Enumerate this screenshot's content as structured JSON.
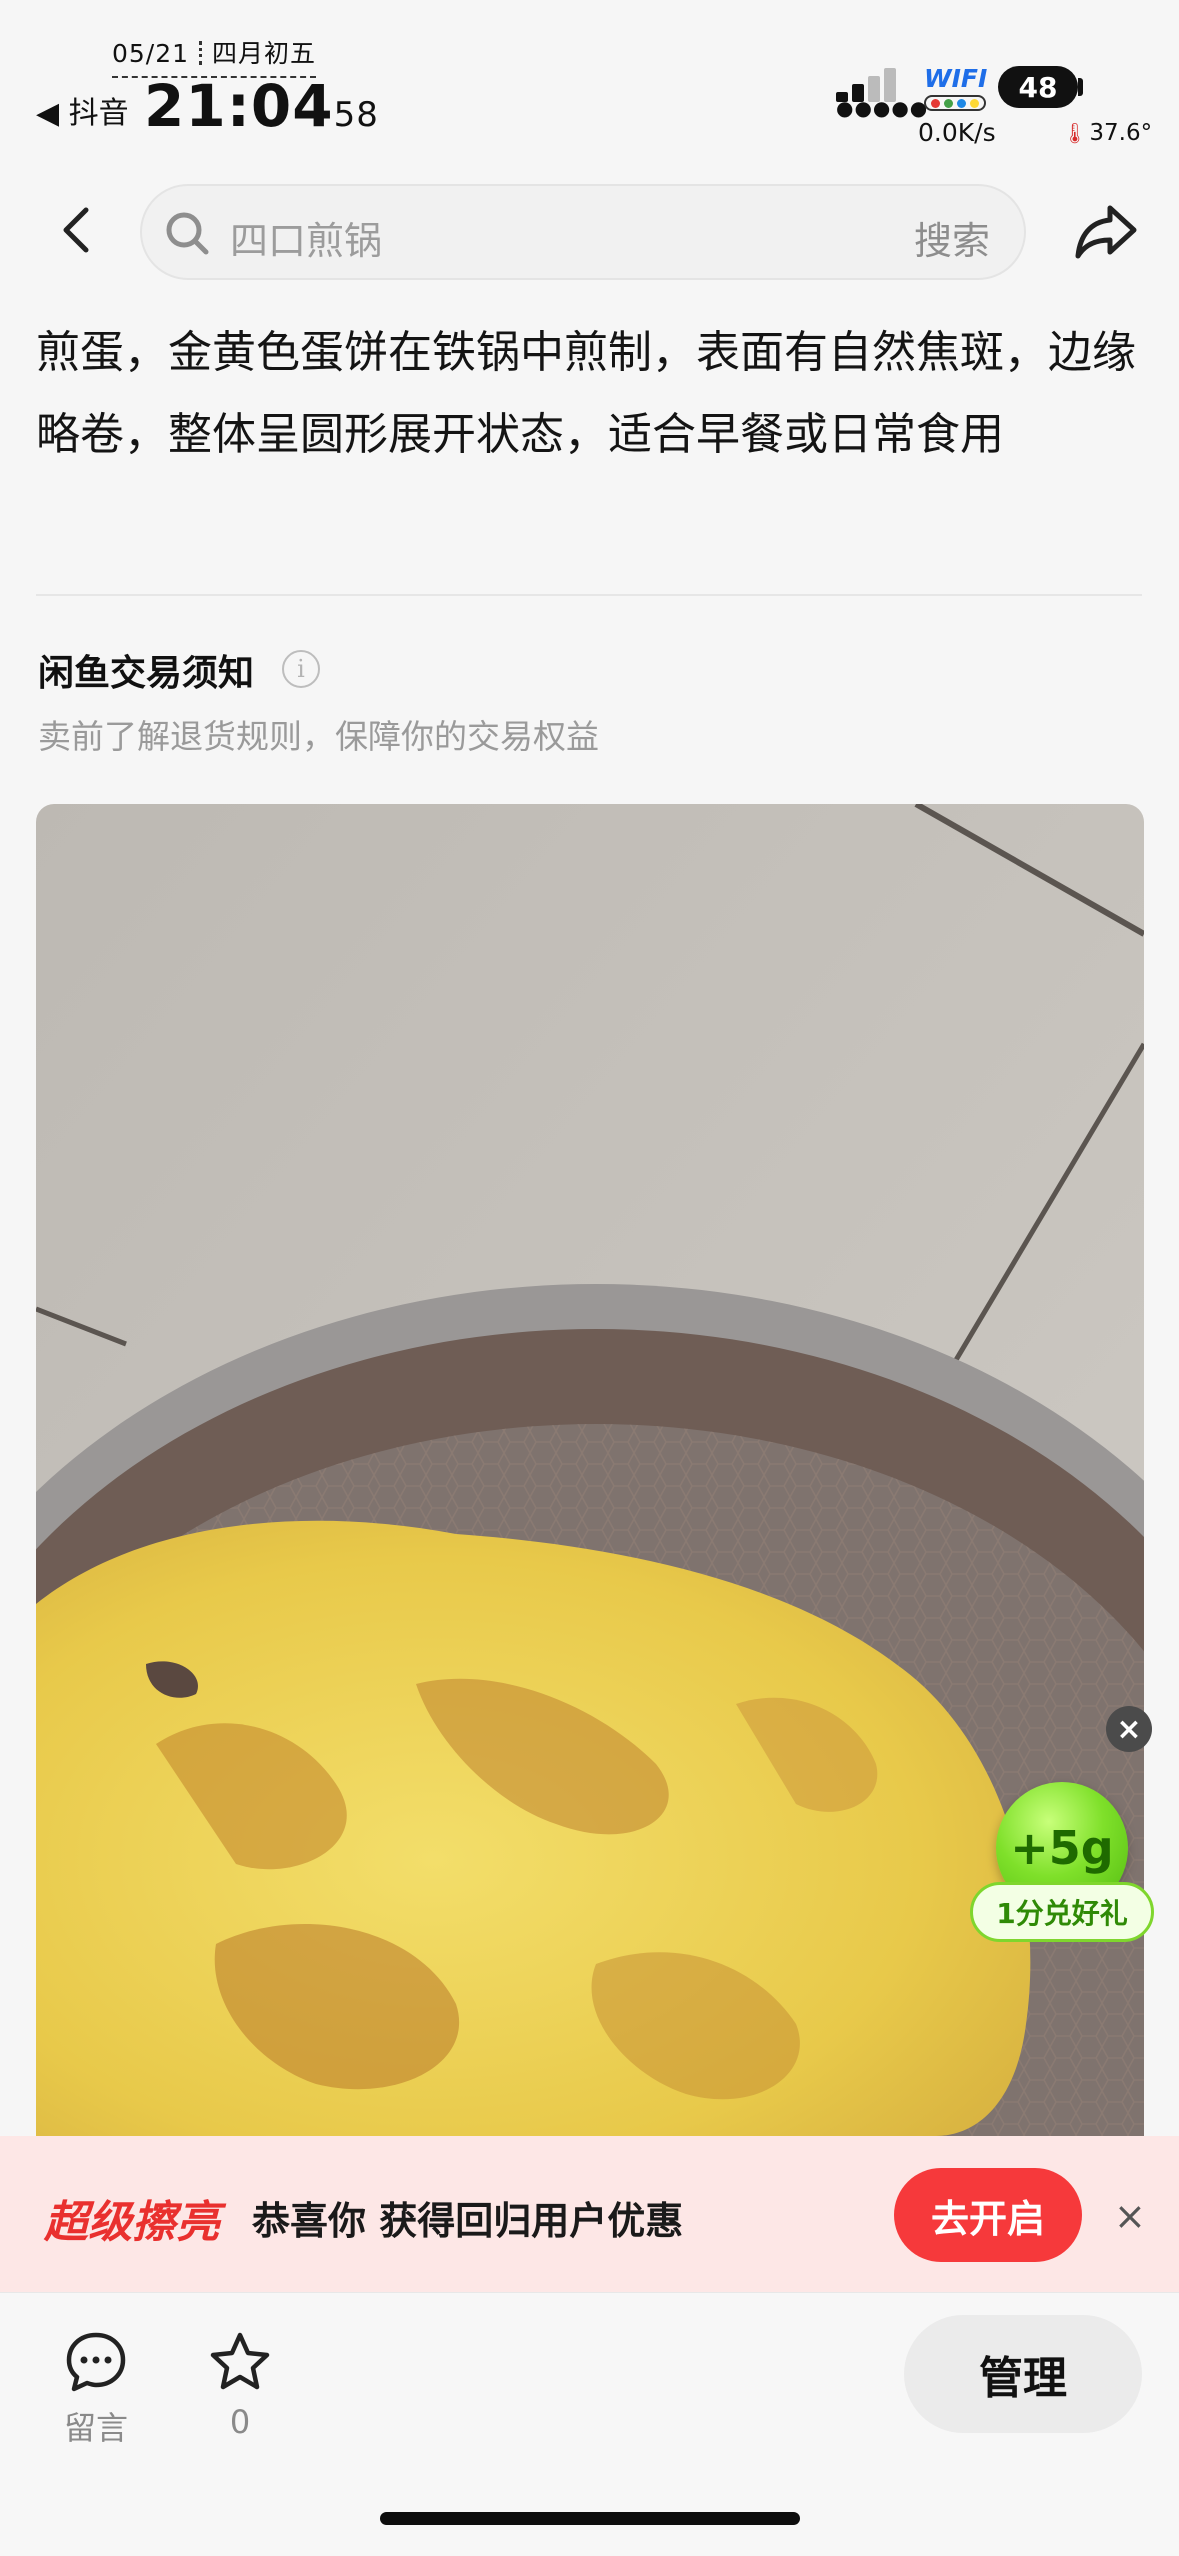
{
  "status_bar": {
    "date": "05/21",
    "lunar": "四月初五",
    "back_app": "◀ 抖音",
    "time_main": "21:04",
    "time_sec": "58",
    "wifi_label": "WIFI",
    "net_speed": "0.0K/s",
    "battery": "48",
    "temperature": "37.6°"
  },
  "nav": {
    "search_query": "四口煎锅",
    "search_button": "搜索"
  },
  "item": {
    "description": "煎蛋，金黄色蛋饼在铁锅中煎制，表面有自然焦斑，边缘略卷，整体呈圆形展开状态，适合早餐或日常食用"
  },
  "notice": {
    "title": "闲鱼交易须知",
    "subtitle": "卖前了解退货规则，保障你的交易权益",
    "info_glyph": "i"
  },
  "reward": {
    "close": "×",
    "amount": "+5g",
    "label": "1分兑好礼"
  },
  "promo": {
    "brand": "超级擦亮",
    "text": "恭喜你 获得回归用户优惠",
    "button": "去开启",
    "close": "×"
  },
  "bottom_bar": {
    "comment_label": "留言",
    "favorite_count": "0",
    "manage_button": "管理"
  },
  "colors": {
    "accent_red": "#f6393b",
    "brand_red": "#e9302e",
    "reward_green": "#7fe02a",
    "promo_bg": "#fde7e6"
  }
}
